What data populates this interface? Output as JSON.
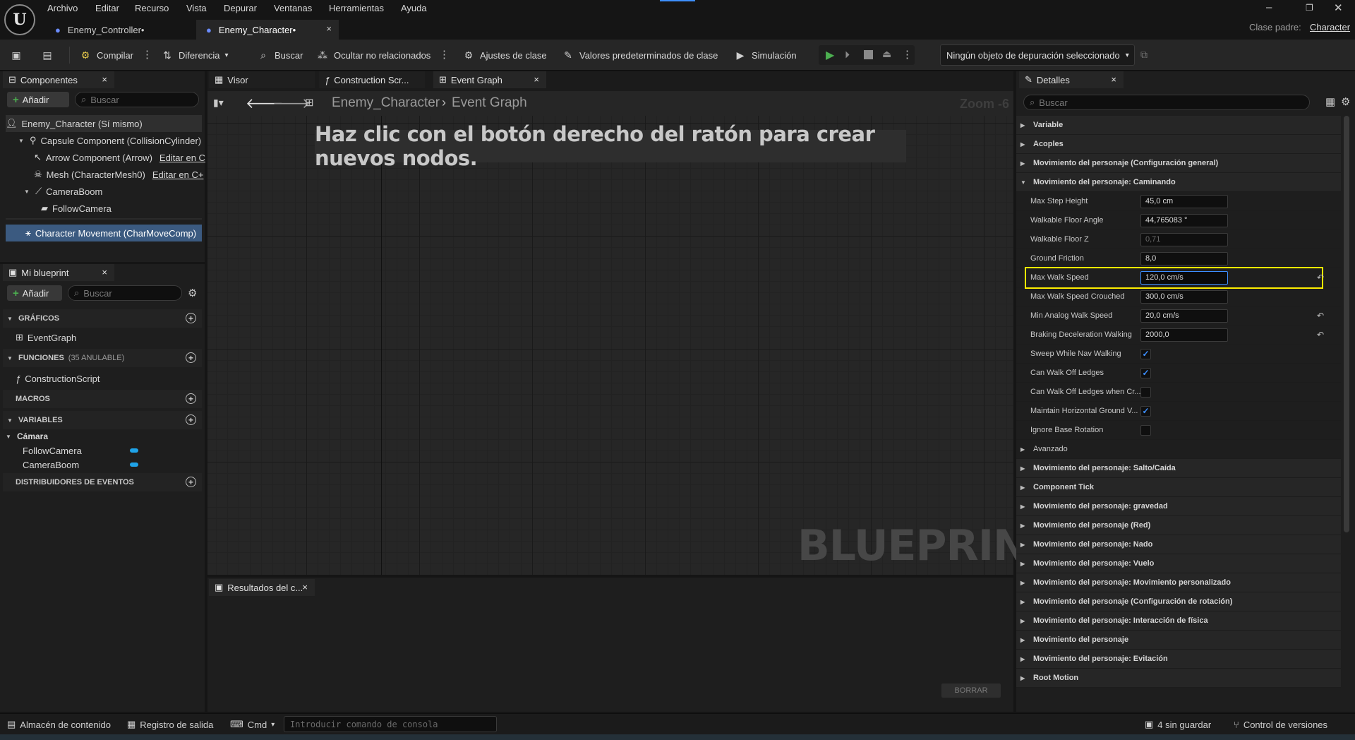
{
  "menu": [
    "Archivo",
    "Editar",
    "Recurso",
    "Vista",
    "Depurar",
    "Ventanas",
    "Herramientas",
    "Ayuda"
  ],
  "tabs": [
    {
      "label": "Enemy_Controller•"
    },
    {
      "label": "Enemy_Character•"
    }
  ],
  "parent_class": {
    "label": "Clase padre:",
    "value": "Character"
  },
  "toolbar": {
    "compile": "Compilar",
    "diff": "Diferencia",
    "find": "Buscar",
    "hide_unrelated": "Ocultar no relacionados",
    "class_settings": "Ajustes de clase",
    "class_defaults": "Valores predeterminados de clase",
    "simulation": "Simulación",
    "debug_object": "Ningún objeto de depuración seleccionado"
  },
  "components": {
    "tab": "Componentes",
    "add": "Añadir",
    "search_placeholder": "Buscar",
    "items": [
      {
        "label": "Enemy_Character (Sí mismo)"
      },
      {
        "label": "Capsule Component (CollisionCylinder)"
      },
      {
        "label": "Arrow Component (Arrow)",
        "link": "Editar en C"
      },
      {
        "label": "Mesh (CharacterMesh0)",
        "link": "Editar en C+"
      },
      {
        "label": "CameraBoom"
      },
      {
        "label": "FollowCamera"
      },
      {
        "label": "Character Movement (CharMoveComp)"
      }
    ]
  },
  "my_blueprint": {
    "tab": "Mi blueprint",
    "add": "Añadir",
    "search_placeholder": "Buscar",
    "graphs_header": "GRÁFICOS",
    "event_graph": "EventGraph",
    "functions_header": "FUNCIONES",
    "functions_count": "(35 ANULABLE)",
    "construction_script": "ConstructionScript",
    "macros_header": "MACROS",
    "variables_header": "VARIABLES",
    "camera_category": "Cámara",
    "variables": [
      "FollowCamera",
      "CameraBoom"
    ],
    "dispatchers_header": "DISTRIBUIDORES DE EVENTOS"
  },
  "graph": {
    "tabs": [
      "Visor",
      "Construction Scr...",
      "Event Graph"
    ],
    "breadcrumb_root": "Enemy_Character",
    "breadcrumb_current": "Event Graph",
    "zoom": "Zoom -6",
    "hint": "Haz clic con el botón derecho del ratón para crear nuevos nodos.",
    "watermark": "BLUEPRINT"
  },
  "compiler_results": {
    "tab": "Resultados del c...",
    "clear": "BORRAR"
  },
  "details": {
    "tab": "Detalles",
    "search_placeholder": "Buscar",
    "categories_top": [
      "Variable",
      "Acoples",
      "Movimiento del personaje (Configuración general)"
    ],
    "expanded_category": "Movimiento del personaje: Caminando",
    "properties": [
      {
        "name": "Max Step Height",
        "value": "45,0 cm",
        "type": "value"
      },
      {
        "name": "Walkable Floor Angle",
        "value": "44,765083 °",
        "type": "value"
      },
      {
        "name": "Walkable Floor Z",
        "value": "0,71",
        "type": "disabled"
      },
      {
        "name": "Ground Friction",
        "value": "8,0",
        "type": "value"
      },
      {
        "name": "Max Walk Speed",
        "value": "120,0 cm/s",
        "type": "focused"
      },
      {
        "name": "Max Walk Speed Crouched",
        "value": "300,0 cm/s",
        "type": "value"
      },
      {
        "name": "Min Analog Walk Speed",
        "value": "20,0 cm/s",
        "type": "value"
      },
      {
        "name": "Braking Deceleration Walking",
        "value": "2000,0",
        "type": "value"
      },
      {
        "name": "Sweep While Nav Walking",
        "checked": true,
        "type": "check"
      },
      {
        "name": "Can Walk Off Ledges",
        "checked": true,
        "type": "check"
      },
      {
        "name": "Can Walk Off Ledges when Cr...",
        "checked": false,
        "type": "check"
      },
      {
        "name": "Maintain Horizontal Ground V...",
        "checked": true,
        "type": "check"
      },
      {
        "name": "Ignore Base Rotation",
        "checked": false,
        "type": "check"
      }
    ],
    "advanced": "Avanzado",
    "categories_bottom": [
      "Movimiento del personaje: Salto/Caída",
      "Component Tick",
      "Movimiento del personaje: gravedad",
      "Movimiento del personaje (Red)",
      "Movimiento del personaje: Nado",
      "Movimiento del personaje: Vuelo",
      "Movimiento del personaje: Movimiento personalizado",
      "Movimiento del personaje (Configuración de rotación)",
      "Movimiento del personaje: Interacción de física",
      "Movimiento del personaje",
      "Movimiento del personaje: Evitación",
      "Root Motion"
    ]
  },
  "statusbar": {
    "content_drawer": "Almacén de contenido",
    "output_log": "Registro de salida",
    "cmd": "Cmd",
    "console_placeholder": "Introducir comando de consola",
    "unsaved": "4 sin guardar",
    "source_control": "Control de versiones"
  },
  "colors": {
    "accent": "#3d8fff",
    "highlight": "#ffee00",
    "play": "#4caf50"
  }
}
